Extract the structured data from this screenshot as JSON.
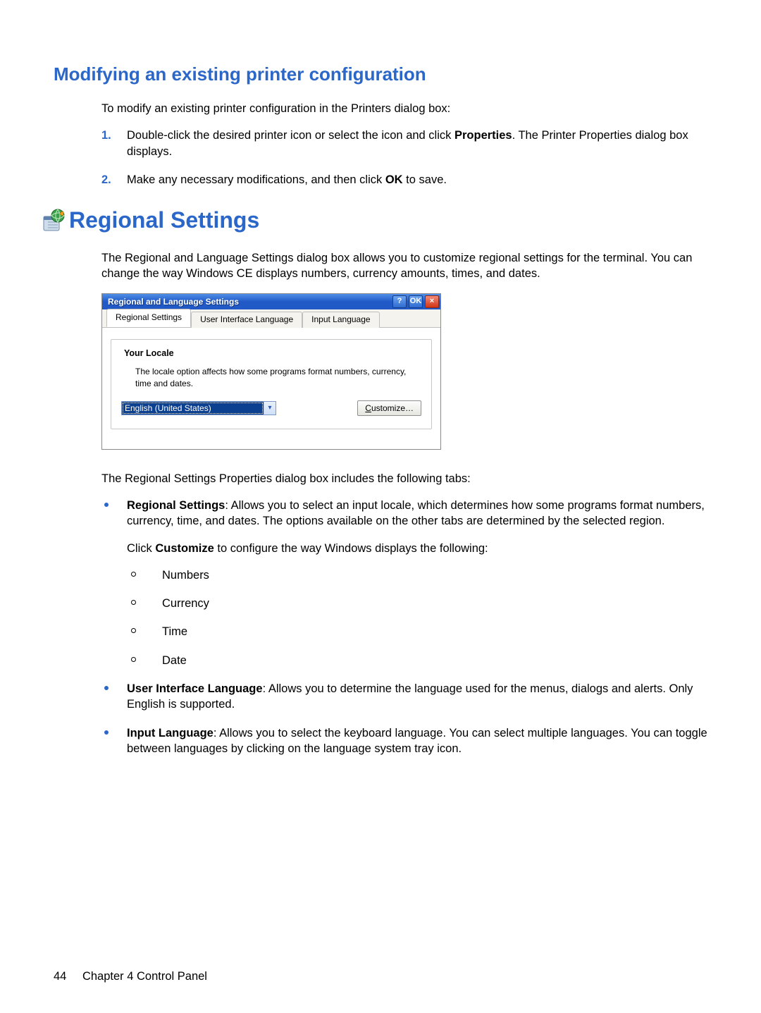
{
  "section1": {
    "heading": "Modifying an existing printer configuration",
    "intro": "To modify an existing printer configuration in the Printers dialog box:",
    "steps": [
      {
        "num": "1.",
        "pre": "Double-click the desired printer icon or select the icon and click ",
        "bold": "Properties",
        "post": ". The Printer Properties dialog box displays."
      },
      {
        "num": "2.",
        "pre": "Make any necessary modifications, and then click ",
        "bold": "OK",
        "post": " to save."
      }
    ]
  },
  "section2": {
    "heading": "Regional Settings",
    "intro": "The Regional and Language Settings dialog box allows you to customize regional settings for the terminal. You can change the way Windows CE displays numbers, currency amounts, times, and dates.",
    "after_dialog": "The Regional Settings Properties dialog box includes the following tabs:",
    "bullets": {
      "regional": {
        "label": "Regional Settings",
        "text": ": Allows you to select an input locale, which determines how some programs format numbers, currency, time, and dates. The options available on the other tabs are determined by the selected region.",
        "customize_pre": "Click ",
        "customize_bold": "Customize",
        "customize_post": " to configure the way Windows displays the following:",
        "subs": [
          "Numbers",
          "Currency",
          "Time",
          "Date"
        ]
      },
      "uil": {
        "label": "User Interface Language",
        "text": ": Allows you to determine the language used for the menus, dialogs and alerts. Only English is supported."
      },
      "input": {
        "label": "Input Language",
        "text": ": Allows you to select the keyboard language. You can select multiple languages. You can toggle between languages by clicking on the language system tray icon."
      }
    }
  },
  "dialog": {
    "title": "Regional and Language Settings",
    "help": "?",
    "ok": "OK",
    "close": "×",
    "tabs": [
      "Regional Settings",
      "User Interface Language",
      "Input Language"
    ],
    "legend": "Your Locale",
    "desc": "The locale option affects how some programs format numbers, currency, time and dates.",
    "selected": "English (United States)",
    "customize_u": "C",
    "customize_rest": "ustomize…"
  },
  "footer": {
    "page": "44",
    "chapter": "Chapter 4   Control Panel"
  }
}
